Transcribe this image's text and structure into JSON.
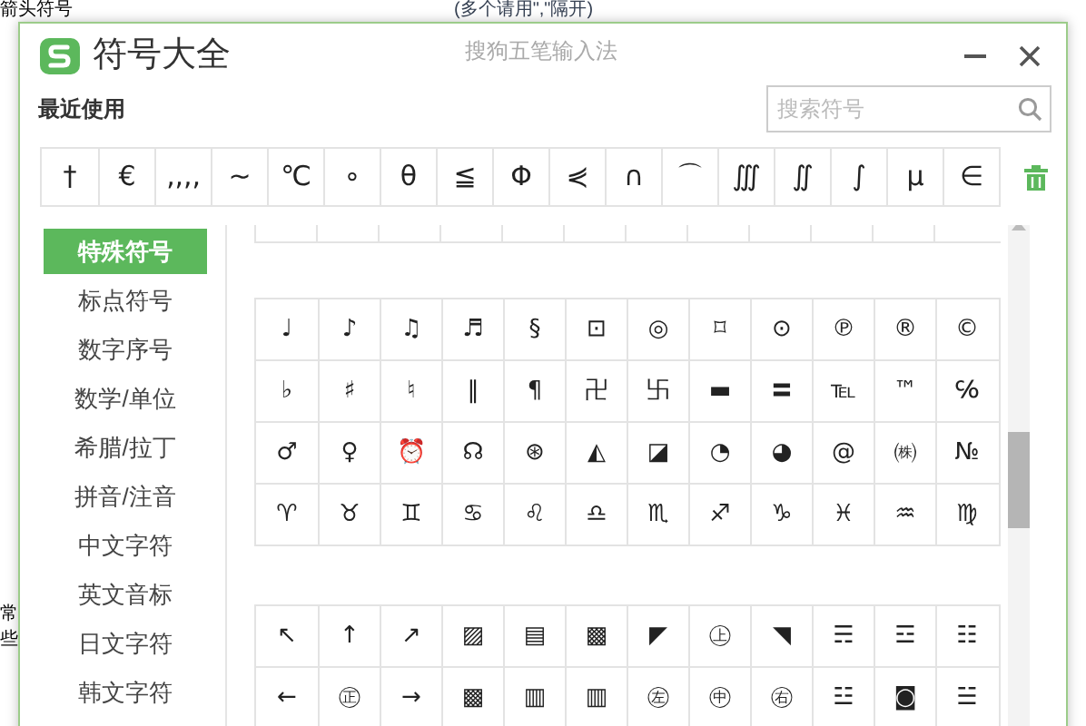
{
  "background": {
    "label": "箭头符号",
    "hint": "(多个请用\",\"隔开)",
    "side_texts": [
      "常",
      "些"
    ]
  },
  "window": {
    "title": "符号大全",
    "subtitle": "搜狗五笔输入法"
  },
  "recent": {
    "label": "最近使用",
    "search": {
      "placeholder": "搜索符号"
    },
    "symbols": [
      "†",
      "€",
      "‚,,,",
      "~",
      "℃",
      "∘",
      "θ",
      "≦",
      "Φ",
      "⋞",
      "∩",
      "⌒",
      "∭",
      "∬",
      "∫",
      "μ",
      "∈"
    ]
  },
  "sidebar": {
    "items": [
      {
        "label": "特殊符号",
        "selected": true
      },
      {
        "label": "标点符号",
        "selected": false
      },
      {
        "label": "数字序号",
        "selected": false
      },
      {
        "label": "数学/单位",
        "selected": false
      },
      {
        "label": "希腊/拉丁",
        "selected": false
      },
      {
        "label": "拼音/注音",
        "selected": false
      },
      {
        "label": "中文字符",
        "selected": false
      },
      {
        "label": "英文音标",
        "selected": false
      },
      {
        "label": "日文字符",
        "selected": false
      },
      {
        "label": "韩文字符",
        "selected": false
      }
    ]
  },
  "groups": [
    {
      "rows": [
        [
          "♩",
          "♪",
          "♫",
          "♬",
          "§",
          "⊡",
          "◎",
          "⌑",
          "⊙",
          "℗",
          "®",
          "©"
        ],
        [
          "♭",
          "♯",
          "♮",
          "‖",
          "¶",
          "卍",
          "卐",
          "▬",
          "〓",
          "℡",
          "™",
          "℅"
        ],
        [
          "♂",
          "♀",
          "⏰",
          "☊",
          "⊛",
          "◭",
          "◪",
          "◔",
          "◕",
          "@",
          "㈱",
          "№"
        ],
        [
          "♈",
          "♉",
          "♊",
          "♋",
          "♌",
          "♎",
          "♏",
          "♐",
          "♑",
          "♓",
          "♒",
          "♍"
        ]
      ]
    },
    {
      "rows": [
        [
          "↖",
          "↑",
          "↗",
          "▨",
          "▤",
          "▩",
          "◤",
          "㊤",
          "◥",
          "☴",
          "☲",
          "☷"
        ],
        [
          "←",
          "㊣",
          "→",
          "▩",
          "▥",
          "▥",
          "㊧",
          "㊥",
          "㊨",
          "☳",
          "◙",
          "☱"
        ]
      ]
    }
  ]
}
